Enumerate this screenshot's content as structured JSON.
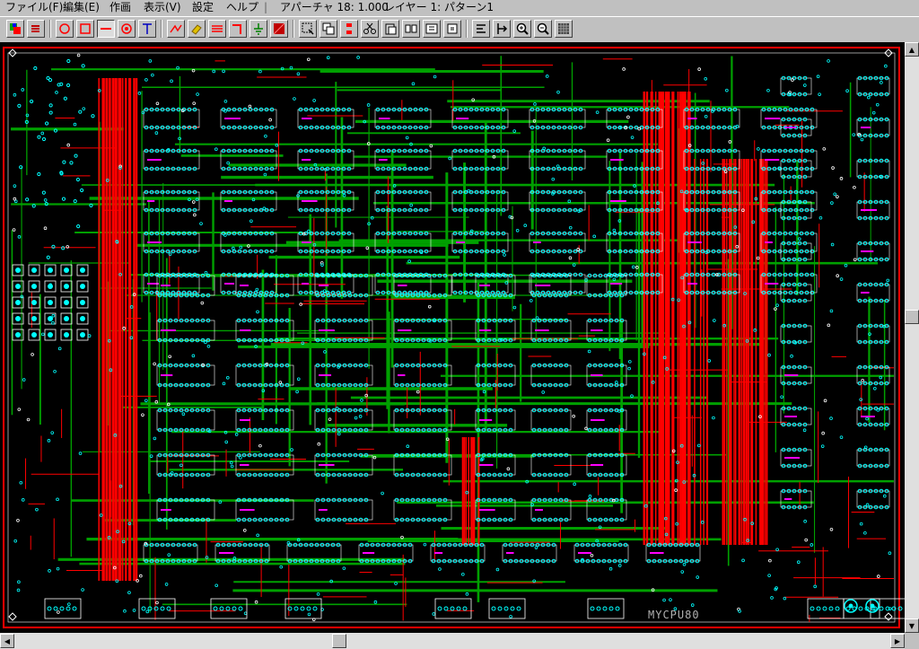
{
  "menu": {
    "file": "ファイル(F)",
    "edit": "編集(E)",
    "draw": "作画",
    "view": "表示(V)",
    "settings": "設定",
    "help": "ヘルプ",
    "divider": "|",
    "aperture": "アパーチャ 18: 1.000",
    "layer": "レイヤー 1: パターン1"
  },
  "toolbar": {
    "icons": [
      "layers-icon",
      "refresh-icon",
      "circle-icon",
      "rectangle-icon",
      "line-icon",
      "pad-icon",
      "text-icon",
      "wire-icon",
      "eraser-icon",
      "parallel-lines-icon",
      "corner-icon",
      "ground-icon",
      "fill-icon",
      "select-icon",
      "copy-icon",
      "move-icon",
      "cut-icon",
      "paste-icon",
      "group-icon",
      "ungroup-icon",
      "frame-icon",
      "align-icon",
      "measure-icon",
      "zoom-in-icon",
      "zoom-out-icon",
      "grid-icon"
    ],
    "pressed": "line-icon"
  },
  "board": {
    "title": "MYCPU80",
    "colors": {
      "background": "#000000",
      "trace_top": "#ff0000",
      "trace_bottom": "#00a000",
      "pads": "#00ffff",
      "silk": "#ffffff",
      "marker": "#ff00ff",
      "outline": "#ff0000"
    }
  }
}
